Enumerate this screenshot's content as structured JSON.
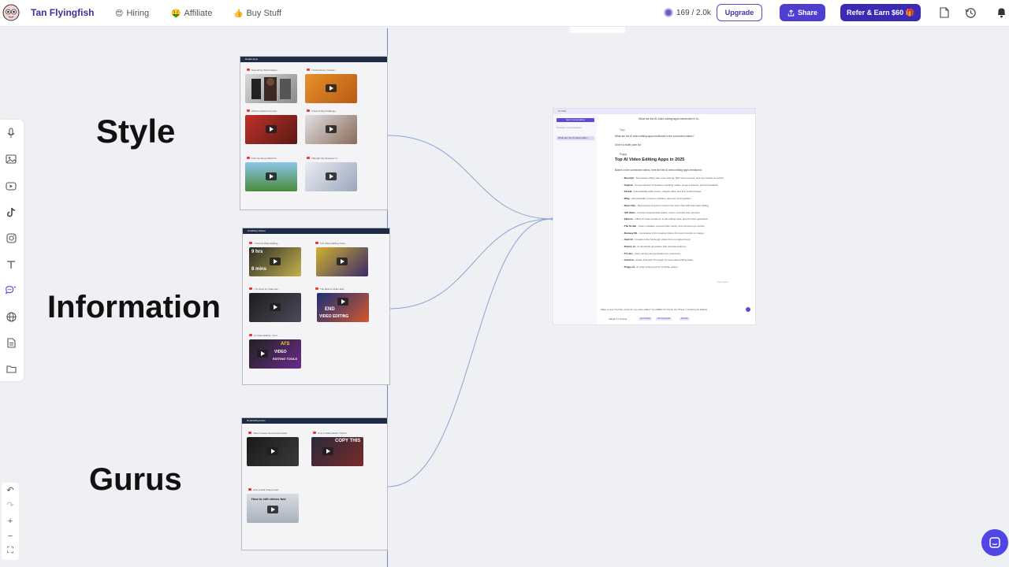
{
  "topbar": {
    "brand": "Tan Flyingfish",
    "nav": [
      {
        "emoji": "😍",
        "label": "Hiring"
      },
      {
        "emoji": "🤑",
        "label": "Affiliate"
      },
      {
        "emoji": "👍",
        "label": "Buy Stuff"
      }
    ],
    "credits": "169 / 2.0k",
    "upgrade_label": "Upgrade",
    "share_label": "Share",
    "refer_label": "Refer & Earn $60 🎁"
  },
  "canvas": {
    "labels": [
      "Style",
      "Information",
      "Gurus"
    ],
    "frames": [
      {
        "title": "Reddit Apps",
        "cards": [
          "Something Weird Happe...",
          "I Tested Every Smartp...",
          "World's Fastest Comput...",
          "I Need a Big Challenge...",
          "I Put Up Every Watch S...",
          "I Bought the Cheapest C..."
        ]
      },
      {
        "title": "AI Editing Videos",
        "cards": [
          "I Tried AI Video Editing...",
          "5 AI Video Editing Tools...",
          "7 AI Tools for Video Ed...",
          "The Best AI Video Edit...",
          "AI Video Editing - Tool..."
        ],
        "thumb_texts": [
          "9 hrs",
          "8 mins",
          "END",
          "VIDEO EDITING",
          "AI'S",
          "VIDEO",
          "EDITING TOOLS"
        ]
      },
      {
        "title": "DoubleWhyGurus",
        "cards": [
          "Video Creator Secrets Revealed",
          "How to Make Better Thumb...",
          "How to Edit Videos Fast..."
        ],
        "thumb_texts": [
          "COPY THIS",
          "How to edit videos fast"
        ]
      }
    ]
  },
  "chat": {
    "header": "AI Chat",
    "question_banner": "What are the AI video editing apps mentioned in th...",
    "new_conversation": "New Conversation",
    "previous_label": "Previous Conversations",
    "previous_item": "What are the AI video editin...",
    "user_name": "Tony",
    "user_q1": "What are the AI video editing apps mentioned in the connected videos?",
    "user_q2": "Give it a bullet point list.",
    "bot_name": "Poppy",
    "answer_title": "Top AI Video Editing Apps in 2025",
    "answer_intro": "Based on the connected videos, here are the AI video editing apps mentioned:",
    "apps": [
      {
        "name": "Descript",
        "desc": "- Text-based editing with voice cloning, filler word removal, and eye contact correction"
      },
      {
        "name": "CapCut",
        "desc": "- Comprehensive AI features including retake, image enhancer, and AI translation"
      },
      {
        "name": "Flowal",
        "desc": "- Automatically adds zooms, chapter titles, and flow & edit footage"
      },
      {
        "name": "Wisp",
        "desc": "- Automatically removes mistakes, silences, and repetition"
      },
      {
        "name": "Opus Clip",
        "desc": "- Repurposes long-form content into short clips with automatic editing"
      },
      {
        "name": "AIS Video",
        "desc": "- Creates AI-generated videos, voices, and ads from prompts"
      },
      {
        "name": "Filmora",
        "desc": "- Offers AI video enhancer, smart editing tools, and AI music generation"
      },
      {
        "name": "The Scribe",
        "desc": "- Clean mistakes, removes filler words, and converts eye contact"
      },
      {
        "name": "Runway ML",
        "desc": "- Generative AI for creating videos from text prompts or images"
      },
      {
        "name": "Invid AI",
        "desc": "- Creates entire full-length videos from a single prompt"
      },
      {
        "name": "Pictory AI",
        "desc": "- AI thumbnail generation with accurate features"
      },
      {
        "name": "Tl Labs",
        "desc": "- Voice cloning and generation for voiceovers"
      },
      {
        "name": "AutoCut",
        "desc": "- Adobe Premiere Pro plugin for automated editing tasks"
      },
      {
        "name": "Poppy AI",
        "desc": "- AI script writing tool for YouTube videos"
      }
    ],
    "reactions": "Copy    Save",
    "input_text": "Make a new YouTube script for my video called \"You NEED To Check Out These 7 Amazing AI Editing",
    "model_label": "Claude 3.7 Sonnet",
    "chips": [
      "Summarize",
      "Get Keywords",
      "Rewrite"
    ]
  },
  "rail": {
    "icons": [
      "microphone-icon",
      "image-icon",
      "youtube-icon",
      "tiktok-icon",
      "instagram-icon",
      "text-icon",
      "ai-chat-icon",
      "globe-icon",
      "document-icon",
      "folder-icon"
    ],
    "zoom": [
      "↶",
      "↷",
      "+",
      "−",
      "⛶"
    ]
  },
  "colors": {
    "brand": "#3d2e9c",
    "accent": "#4f3fd0",
    "canvas_bg": "#eef0f3",
    "frame_head": "#1f2a44",
    "connector": "#7f9bd2"
  }
}
